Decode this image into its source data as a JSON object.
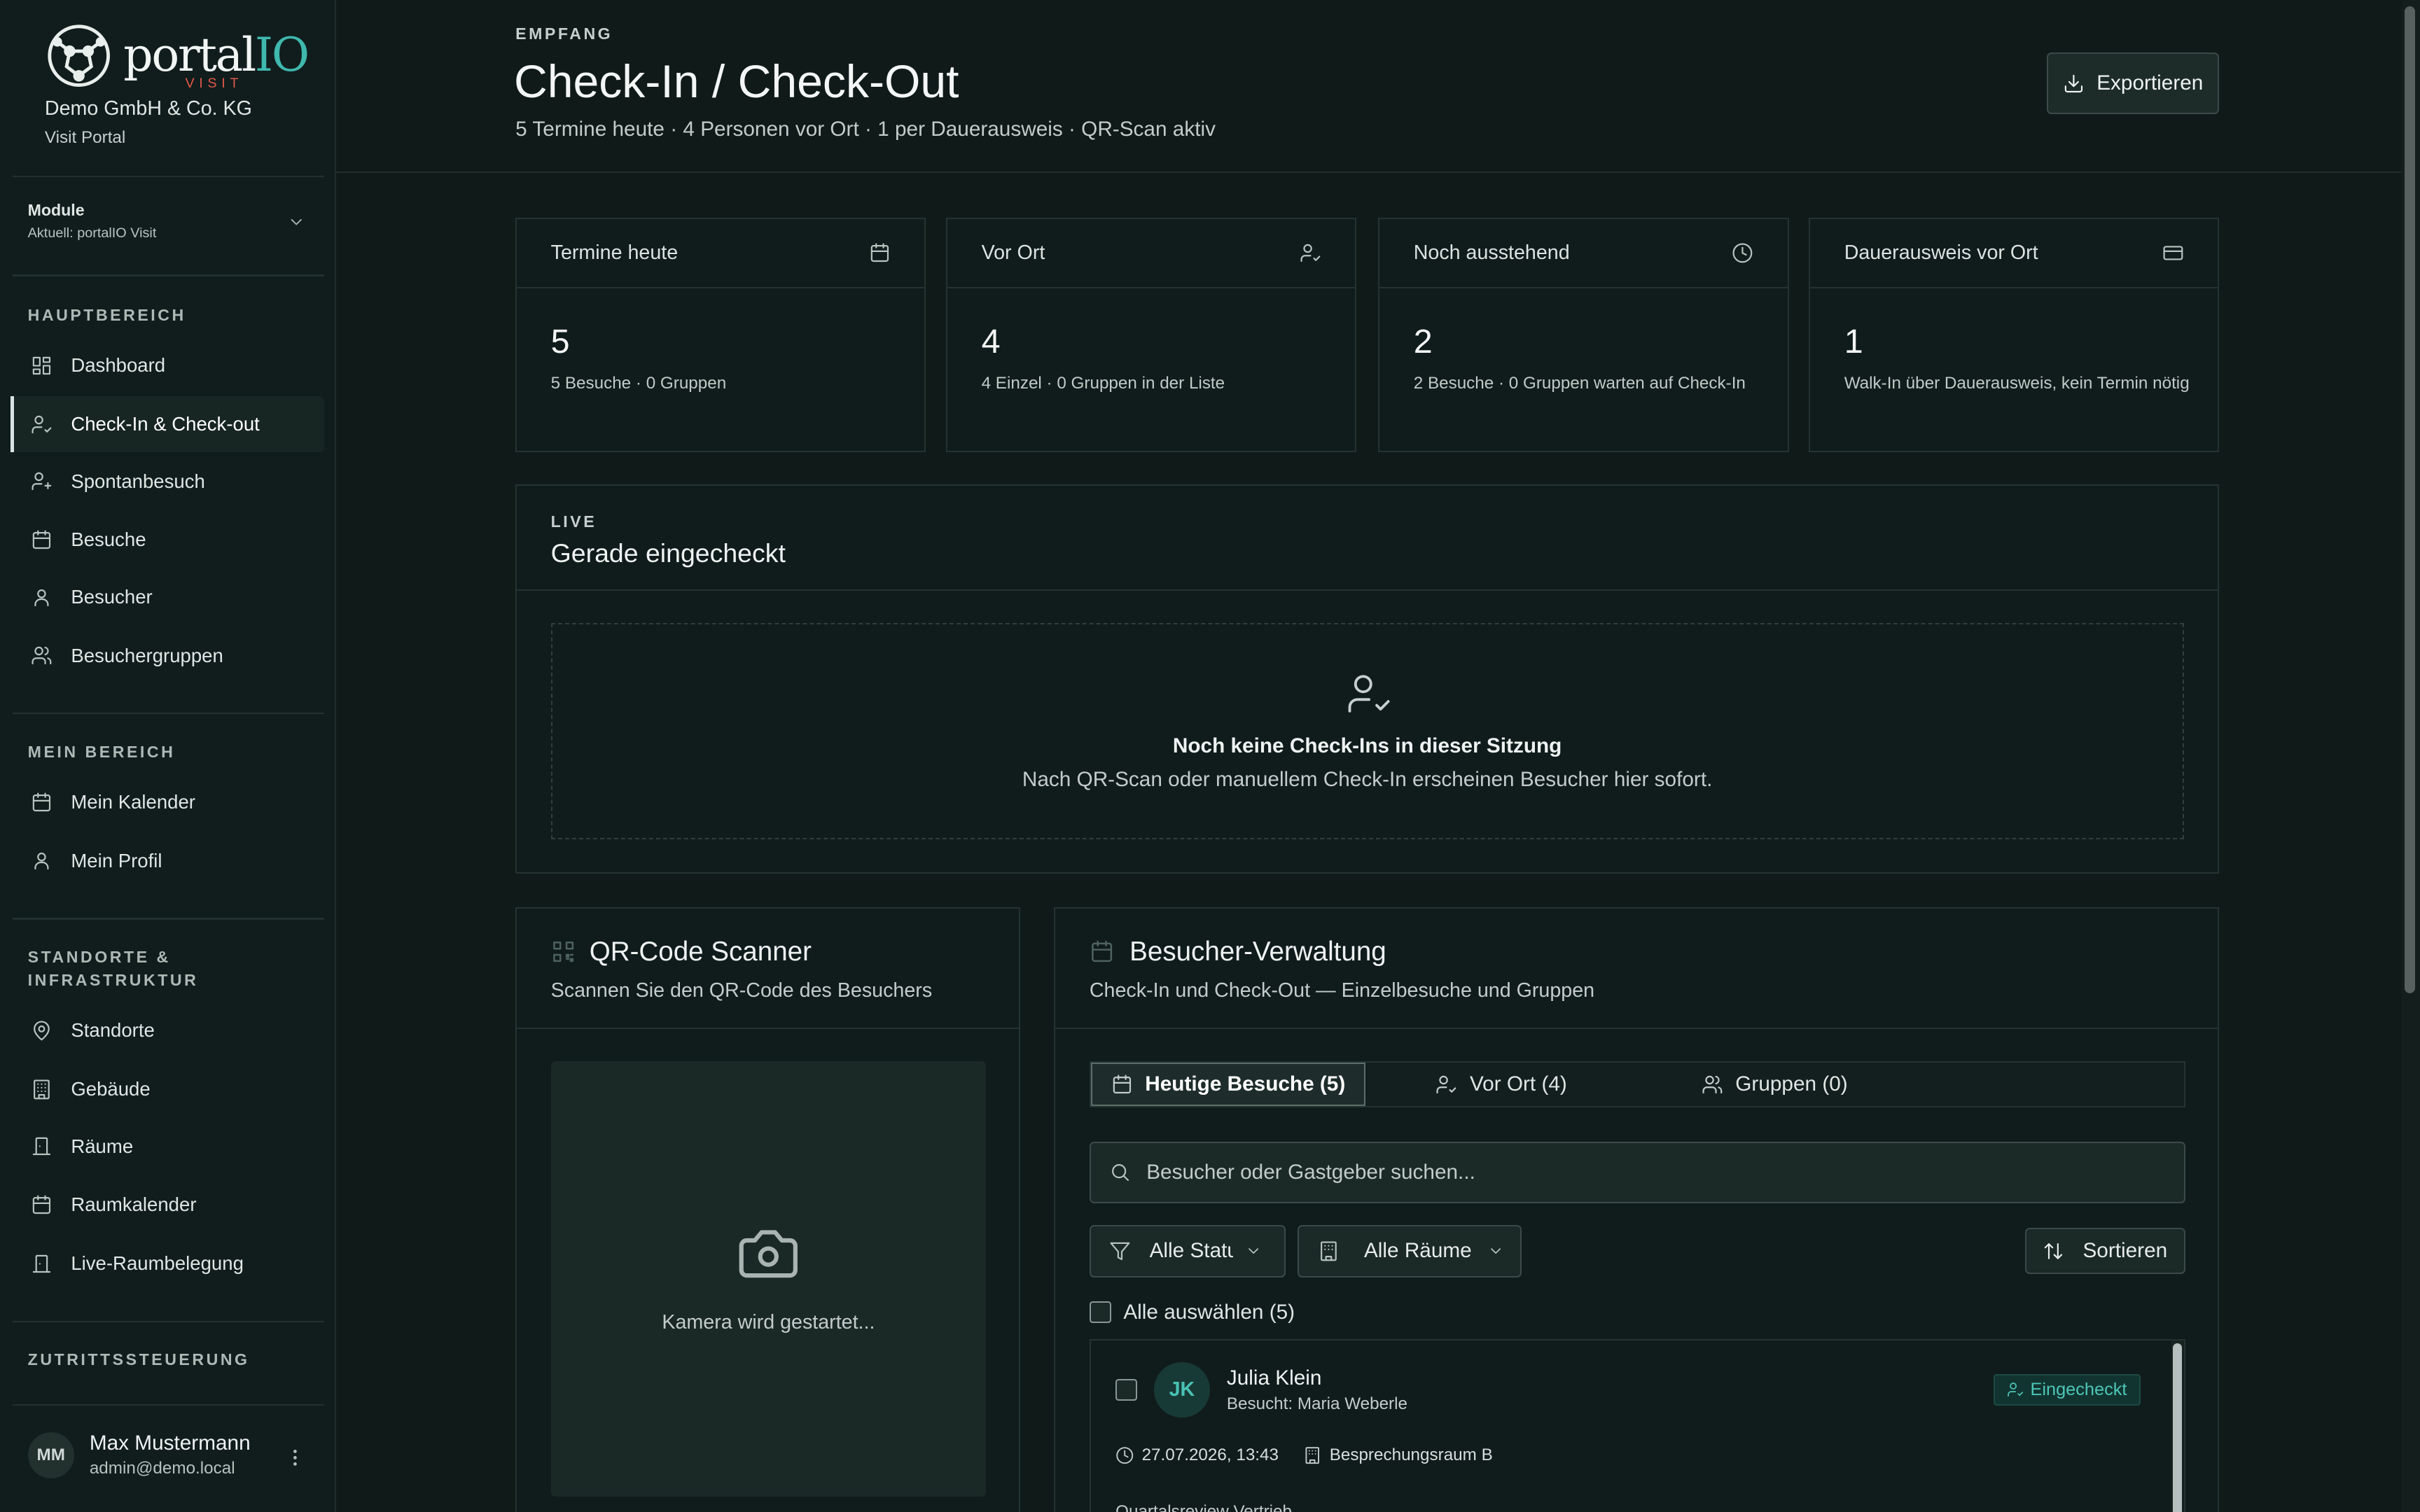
{
  "brand": {
    "logo_main": "portal",
    "logo_accent": "IO",
    "logo_sub": "VISIT",
    "org": "Demo GmbH & Co. KG",
    "portal": "Visit Portal",
    "accent_color": "#3fb8ae",
    "visit_color": "#e0574a"
  },
  "module": {
    "title": "Module",
    "current": "Aktuell: portalIO Visit"
  },
  "nav": {
    "section_main": "HAUPTBEREICH",
    "main": [
      {
        "label": "Dashboard",
        "icon": "grid-icon"
      },
      {
        "label": "Check-In & Check-out",
        "icon": "user-check-icon"
      },
      {
        "label": "Spontanbesuch",
        "icon": "user-plus-icon"
      },
      {
        "label": "Besuche",
        "icon": "calendar-icon"
      },
      {
        "label": "Besucher",
        "icon": "user-icon"
      },
      {
        "label": "Besuchergruppen",
        "icon": "users-icon"
      }
    ],
    "section_mine": "MEIN BEREICH",
    "mine": [
      {
        "label": "Mein Kalender",
        "icon": "calendar-icon"
      },
      {
        "label": "Mein Profil",
        "icon": "user-icon"
      }
    ],
    "section_sites": "STANDORTE & INFRASTRUKTUR",
    "sites": [
      {
        "label": "Standorte",
        "icon": "map-pin-icon"
      },
      {
        "label": "Gebäude",
        "icon": "building-icon"
      },
      {
        "label": "Räume",
        "icon": "door-icon"
      },
      {
        "label": "Raumkalender",
        "icon": "calendar-icon"
      },
      {
        "label": "Live-Raumbelegung",
        "icon": "door-icon"
      }
    ],
    "section_access": "ZUTRITTSSTEUERUNG"
  },
  "user": {
    "initials": "MM",
    "name": "Max Mustermann",
    "email": "admin@demo.local"
  },
  "header": {
    "eyebrow": "EMPFANG",
    "title": "Check-In / Check-Out",
    "subtitle": "5 Termine heute · 4 Personen vor Ort · 1 per Dauerausweis · QR-Scan aktiv",
    "export_label": "Exportieren"
  },
  "stats": [
    {
      "title": "Termine heute",
      "value": "5",
      "sub": "5 Besuche · 0 Gruppen",
      "icon": "calendar-icon"
    },
    {
      "title": "Vor Ort",
      "value": "4",
      "sub": "4 Einzel · 0 Gruppen in der Liste",
      "icon": "user-check-icon"
    },
    {
      "title": "Noch ausstehend",
      "value": "2",
      "sub": "2 Besuche · 0 Gruppen warten auf Check-In",
      "icon": "clock-icon"
    },
    {
      "title": "Dauerausweis vor Ort",
      "value": "1",
      "sub": "Walk-In über Dauerausweis, kein Termin nötig",
      "icon": "card-icon"
    }
  ],
  "live": {
    "label": "LIVE",
    "title": "Gerade eingecheckt",
    "empty_title": "Noch keine Check-Ins in dieser Sitzung",
    "empty_text": "Nach QR-Scan oder manuellem Check-In erscheinen Besucher hier sofort."
  },
  "qr": {
    "title": "QR-Code Scanner",
    "subtitle": "Scannen Sie den QR-Code des Besuchers",
    "camera_status": "Kamera wird gestartet..."
  },
  "mgmt": {
    "title": "Besucher-Verwaltung",
    "subtitle": "Check-In und Check-Out — Einzelbesuche und Gruppen",
    "tabs": [
      {
        "label": "Heutige Besuche (5)",
        "icon": "calendar-icon"
      },
      {
        "label": "Vor Ort (4)",
        "icon": "user-check-icon"
      },
      {
        "label": "Gruppen (0)",
        "icon": "users-icon"
      }
    ],
    "search_placeholder": "Besucher oder Gastgeber suchen...",
    "filter_status": "Alle Status",
    "filter_rooms": "Alle Räume",
    "sort_label": "Sortieren",
    "select_all": "Alle auswählen (5)",
    "visits": [
      {
        "initials": "JK",
        "name": "Julia Klein",
        "host": "Besucht: Maria Weberle",
        "status": "Eingecheckt",
        "datetime": "27.07.2026, 13:43",
        "room": "Besprechungsraum B",
        "note": "Quartalsreview Vertrieb"
      }
    ]
  }
}
